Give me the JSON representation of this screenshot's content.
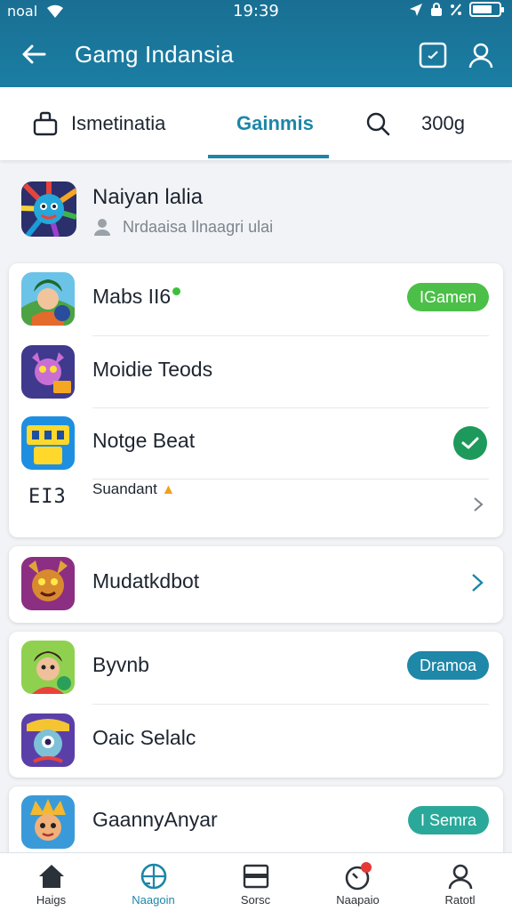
{
  "status": {
    "carrier": "noal",
    "time": "19:39",
    "battery_level": 0.75
  },
  "appbar": {
    "title": "Gamg Indansia",
    "back_icon": "arrow-left-icon",
    "actions": [
      "chat-icon",
      "user-icon"
    ]
  },
  "tabs": [
    {
      "label": "Ismetinatia",
      "icon": "bag-icon"
    },
    {
      "label": "Gainmis",
      "active": true
    },
    {
      "label": "300g",
      "icon": "search-icon"
    }
  ],
  "profile": {
    "name": "Naiyan lalia",
    "subtitle": "Nrdaaisa Ilnaagri ulai"
  },
  "cards": [
    {
      "rows": [
        {
          "label": "Mabs II6",
          "badge": "IGamen",
          "badge_color": "#4cbf49"
        },
        {
          "label": "Moidie Teods"
        },
        {
          "label": "Notge Beat",
          "status": "checked"
        },
        {
          "label": "Suandant",
          "code": "EI3"
        }
      ]
    },
    {
      "rows": [
        {
          "label": "Mudatkdbot"
        }
      ]
    },
    {
      "rows": [
        {
          "label": "Byvnb",
          "badge": "Dramoa",
          "badge_color": "#1f87a8"
        },
        {
          "label": "Oaic Selalc"
        }
      ]
    },
    {
      "rows": [
        {
          "label": "GaannyAnyar",
          "badge": "I Semra",
          "badge_color": "#2aa99a"
        }
      ]
    }
  ],
  "bottom_nav": [
    {
      "label": "Haigs",
      "icon": "home-icon"
    },
    {
      "label": "Naagoin",
      "icon": "globe-icon",
      "active": true
    },
    {
      "label": "Sorsc",
      "icon": "store-icon"
    },
    {
      "label": "Naapaio",
      "icon": "stopwatch-icon",
      "notification": true
    },
    {
      "label": "Ratotl",
      "icon": "profile-icon"
    }
  ],
  "colors": {
    "header": "#1b7ea3",
    "accent": "#1c86a8",
    "success": "#1d9a5b"
  }
}
